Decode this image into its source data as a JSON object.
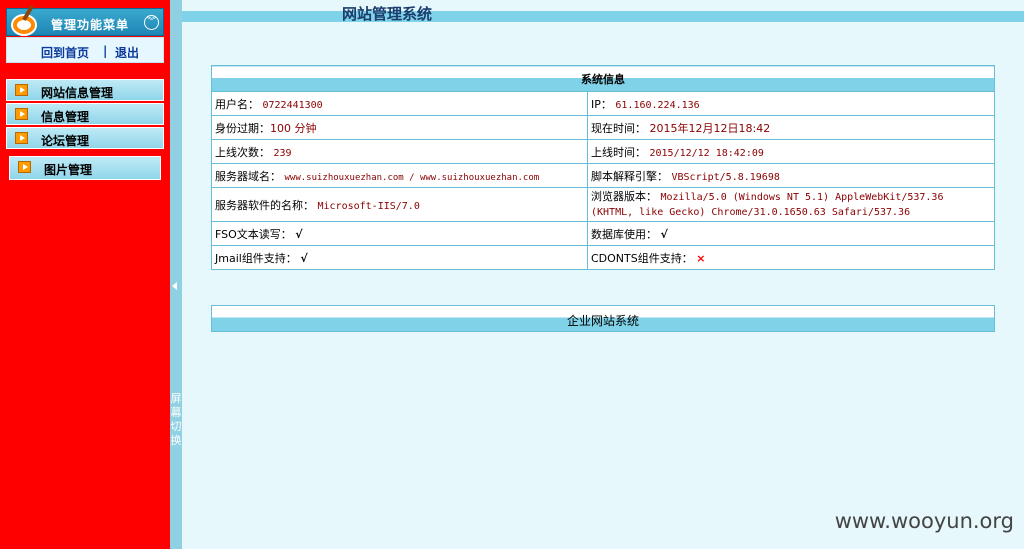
{
  "sidebar": {
    "menu_title": "管理功能菜单",
    "collapse_icon": "double-chevron-down-icon",
    "home_link": "回到首页",
    "separator": "|",
    "logout_link": "退出",
    "items": [
      {
        "label": "网站信息管理"
      },
      {
        "label": "信息管理"
      },
      {
        "label": "论坛管理"
      },
      {
        "label": "图片管理"
      }
    ],
    "toggle_text": "屏幕切换"
  },
  "header": {
    "title": "网站管理系统"
  },
  "system_info": {
    "heading": "系统信息",
    "rows": [
      {
        "l_label": "用户名：",
        "l_value": "0722441300",
        "r_label": "IP：",
        "r_value": "61.160.224.136"
      },
      {
        "l_label": "身份过期：",
        "l_value": "100 分钟",
        "r_label": "现在时间：",
        "r_value": "2015年12月12日18:42"
      },
      {
        "l_label": "上线次数：",
        "l_value": "239",
        "r_label": "上线时间：",
        "r_value": "2015/12/12 18:42:09"
      },
      {
        "l_label": "服务器域名：",
        "l_value": "www.suizhouxuezhan.com / www.suizhouxuezhan.com",
        "r_label": "脚本解释引擎：",
        "r_value": "VBScript/5.8.19698"
      },
      {
        "l_label": "服务器软件的名称：",
        "l_value": "Microsoft-IIS/7.0",
        "r_label": "浏览器版本：",
        "r_value": "Mozilla/5.0 (Windows NT 5.1) AppleWebKit/537.36 (KHTML, like Gecko) Chrome/31.0.1650.63 Safari/537.36"
      },
      {
        "l_label": "FSO文本读写：",
        "l_value": "√",
        "r_label": "数据库使用：",
        "r_value": "√"
      },
      {
        "l_label": "Jmail组件支持：",
        "l_value": "√",
        "r_label": "CDONTS组件支持：",
        "r_value": "×"
      }
    ]
  },
  "footer": {
    "text": "企业网站系统"
  },
  "watermark": "www.wooyun.org",
  "colors": {
    "sidebar_bg": "#ff0000",
    "accent": "#7fd2e8",
    "value_text": "#8b0000"
  }
}
